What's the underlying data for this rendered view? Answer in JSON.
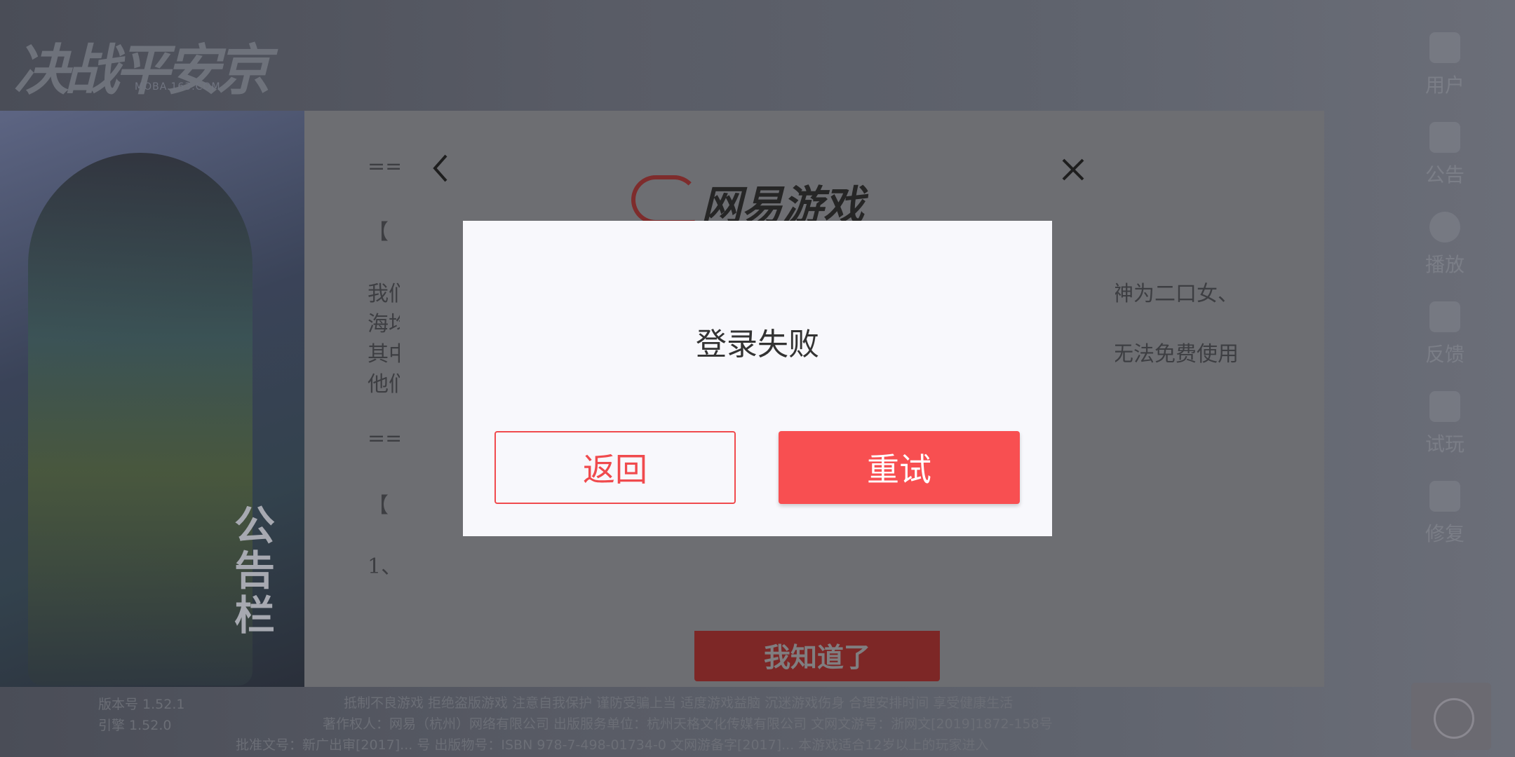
{
  "game": {
    "logo_text": "决战平安京",
    "logo_sub": "MOBA.163.COM"
  },
  "side_menu": [
    {
      "label": "用户",
      "icon": "user-icon"
    },
    {
      "label": "公告",
      "icon": "notice-icon"
    },
    {
      "label": "播放",
      "icon": "film-reel-icon"
    },
    {
      "label": "反馈",
      "icon": "edit-icon"
    },
    {
      "label": "试玩",
      "icon": "monitor-icon"
    },
    {
      "label": "修复",
      "icon": "wrench-icon"
    }
  ],
  "board": {
    "vertical_label": "公告栏",
    "lines": [
      "==",
      "【 ",
      "我们",
      "海均",
      "其中",
      "他们",
      "==",
      "【 ",
      "1、"
    ],
    "right_lines": [
      "神为二口女、",
      "无法免费使用"
    ],
    "ack_button": "我知道了"
  },
  "footer": {
    "version": "版本号 1.52.1",
    "engine": "引擎 1.52.0",
    "line1": "抵制不良游戏 拒绝盗版游戏 注意自我保护 谨防受骗上当 适度游戏益脑 沉迷游戏伤身 合理安排时间 享受健康生活",
    "line2": "著作权人：网易（杭州）网络有限公司    出版服务单位：杭州天格文化传媒有限公司    文网文游号：浙网文[2019]1872-158号",
    "line3": "批准文号：新广出审[2017]... 号    出版物号：ISBN 978-7-498-01734-0    文网游备字[2017]... 本游戏适合12岁以上的玩家进入"
  },
  "sdk": {
    "logo_text": "网易游戏"
  },
  "dialog": {
    "title": "登录失败",
    "back_label": "返回",
    "retry_label": "重试"
  }
}
